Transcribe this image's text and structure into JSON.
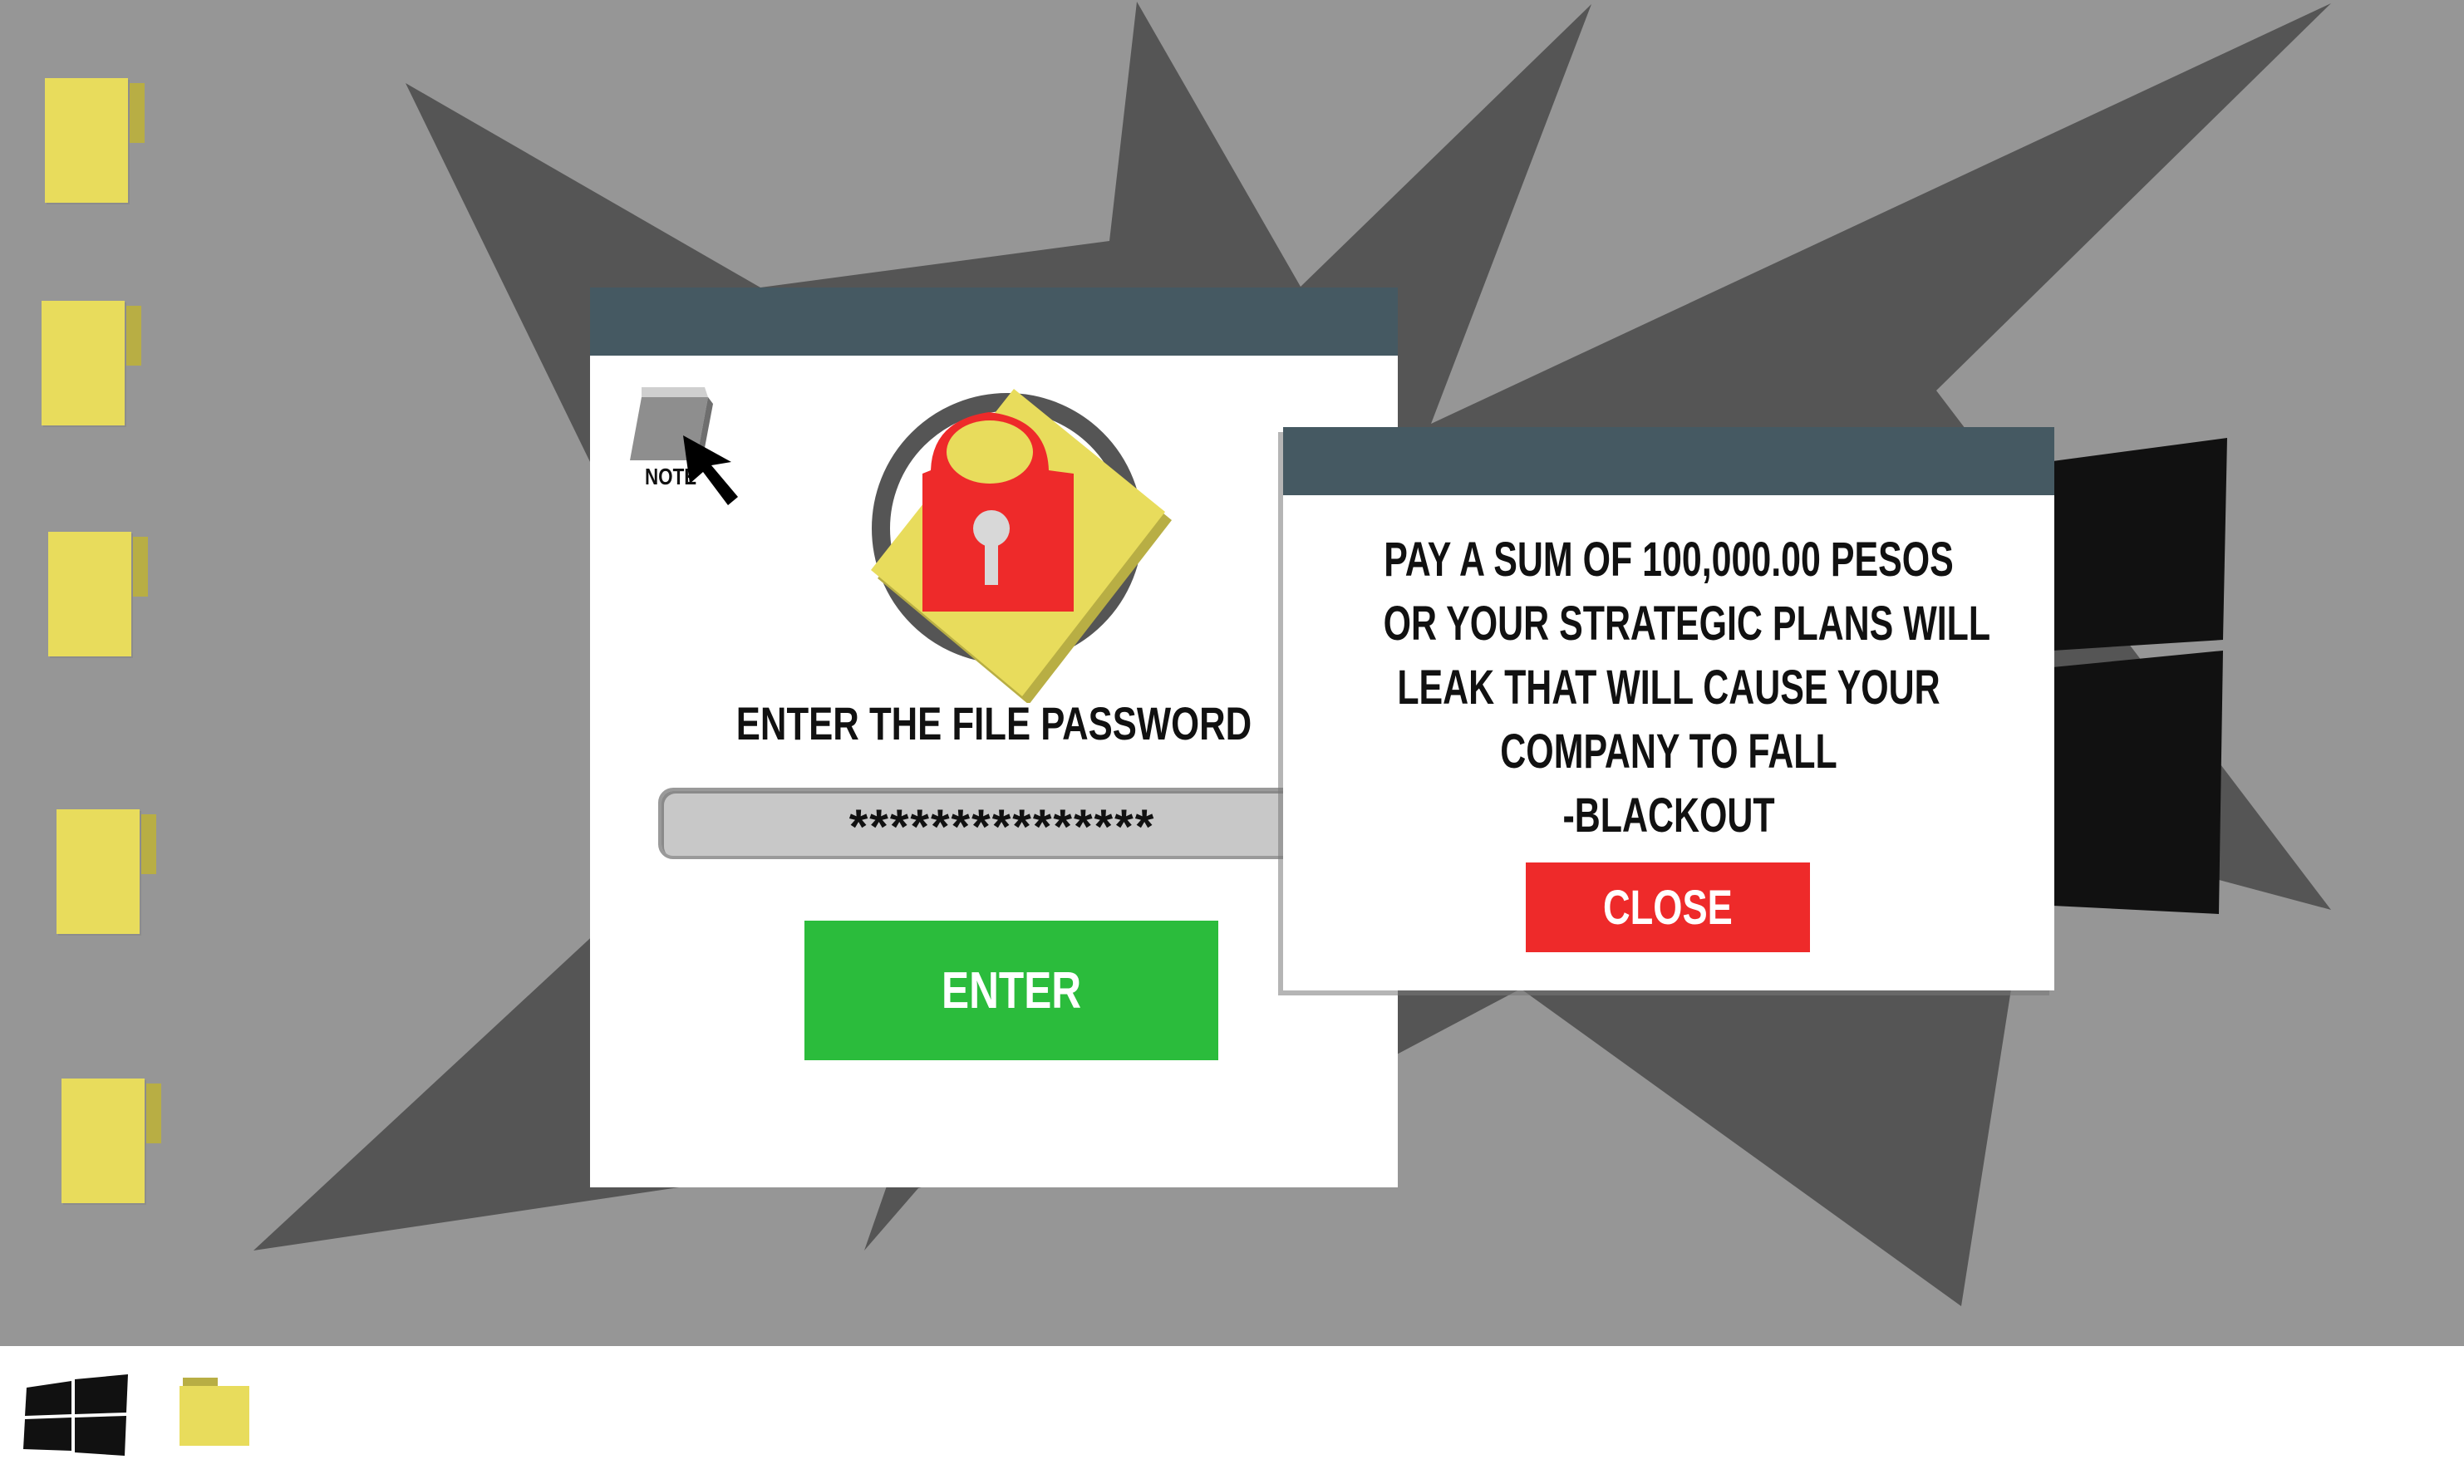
{
  "desktop": {
    "background_color": "#969696",
    "burst_color": "#555555",
    "icons": [
      {
        "name": "folder",
        "color": "#e8dc5c"
      },
      {
        "name": "folder",
        "color": "#e8dc5c"
      },
      {
        "name": "folder",
        "color": "#e8dc5c"
      },
      {
        "name": "folder",
        "color": "#e8dc5c"
      },
      {
        "name": "folder",
        "color": "#e8dc5c"
      }
    ]
  },
  "password_window": {
    "titlebar_color": "#455962",
    "note_label": "NOTE",
    "prompt": "ENTER THE FILE PASSWORD",
    "password_value": "***************",
    "enter_label": "ENTER",
    "enter_color": "#2bbc3c",
    "lock_color": "#ee2a2a"
  },
  "ransom_window": {
    "titlebar_color": "#455962",
    "message_lines": [
      "PAY A SUM OF 100,000.00 PESOS",
      "OR YOUR STRATEGIC PLANS WILL",
      "LEAK THAT WILL CAUSE YOUR",
      "COMPANY TO FALL",
      "-BLACKOUT"
    ],
    "close_label": "CLOSE",
    "close_color": "#ee2a2a"
  },
  "taskbar": {
    "start_icon": "windows-icon",
    "pinned": [
      "folder-icon"
    ]
  }
}
